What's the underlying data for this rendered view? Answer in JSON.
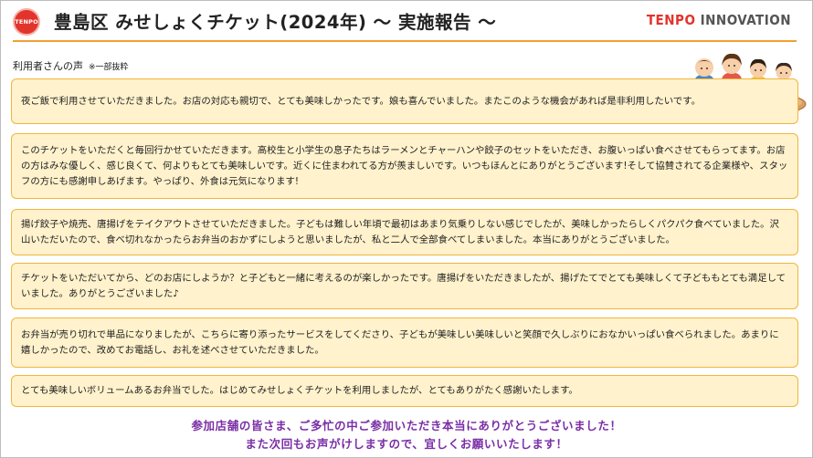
{
  "header": {
    "logo_text": "TENPO",
    "title": "豊島区 みせしょくチケット(2024年) ～ 実施報告 ～",
    "brand_part1": "TENPO",
    "brand_part2": "INNOVATION"
  },
  "section": {
    "label": "利用者さんの声",
    "note": "※一部抜粋"
  },
  "comments": [
    "夜ご飯で利用させていただきました。お店の対応も親切で、とても美味しかったです。娘も喜んでいました。またこのような機会があれば是非利用したいです。",
    "このチケットをいただくと毎回行かせていただきます。高校生と小学生の息子たちはラーメンとチャーハンや餃子のセットをいただき、お腹いっぱい食べさせてもらってます。お店の方はみな優しく、感じ良くて、何よりもとても美味しいです。近くに住まわれてる方が羨ましいです。いつもほんとにありがとうございます!そして協賛されてる企業様や、スタッフの方にも感謝申しあげます。やっぱり、外食は元気になります!",
    "揚げ餃子や焼売、唐揚げをテイクアウトさせていただきました。子どもは難しい年頃で最初はあまり気乗りしない感じでしたが、美味しかったらしくパクパク食べていました。沢山いただいたので、食べ切れなかったらお弁当のおかずにしようと思いましたが、私と二人で全部食べてしまいました。本当にありがとうございました。",
    "チケットをいただいてから、どのお店にしようか？と子どもと一緒に考えるのが楽しかったです。唐揚げをいただきましたが、揚げたてでとても美味しくて子どももとても満足していました。ありがとうございました♪",
    "お弁当が売り切れで単品になりましたが、こちらに寄り添ったサービスをしてくださり、子どもが美味しい美味しいと笑顔で久しぶりにおなかいっぱい食べられました。あまりに嬉しかったので、改めてお電話し、お礼を述べさせていただきました。",
    "とても美味しいボリュームあるお弁当でした。はじめてみせしょくチケットを利用しましたが、とてもありがたく感謝いたします。"
  ],
  "footer": {
    "line1": "参加店舗の皆さま、ご多忙の中ご参加いただき本当にありがとうございました！",
    "line2": "また次回もお声がけしますので、宜しくお願いいたします！"
  },
  "colors": {
    "accent_orange": "#f0a030",
    "card_fill": "#fff2cc",
    "card_border": "#f2b53a",
    "brand_red": "#e3342c",
    "footer_purple": "#7a2ea6"
  },
  "icons": {
    "logo": "tenpo-logo-badge",
    "illustration": "family-eating-illustration"
  }
}
